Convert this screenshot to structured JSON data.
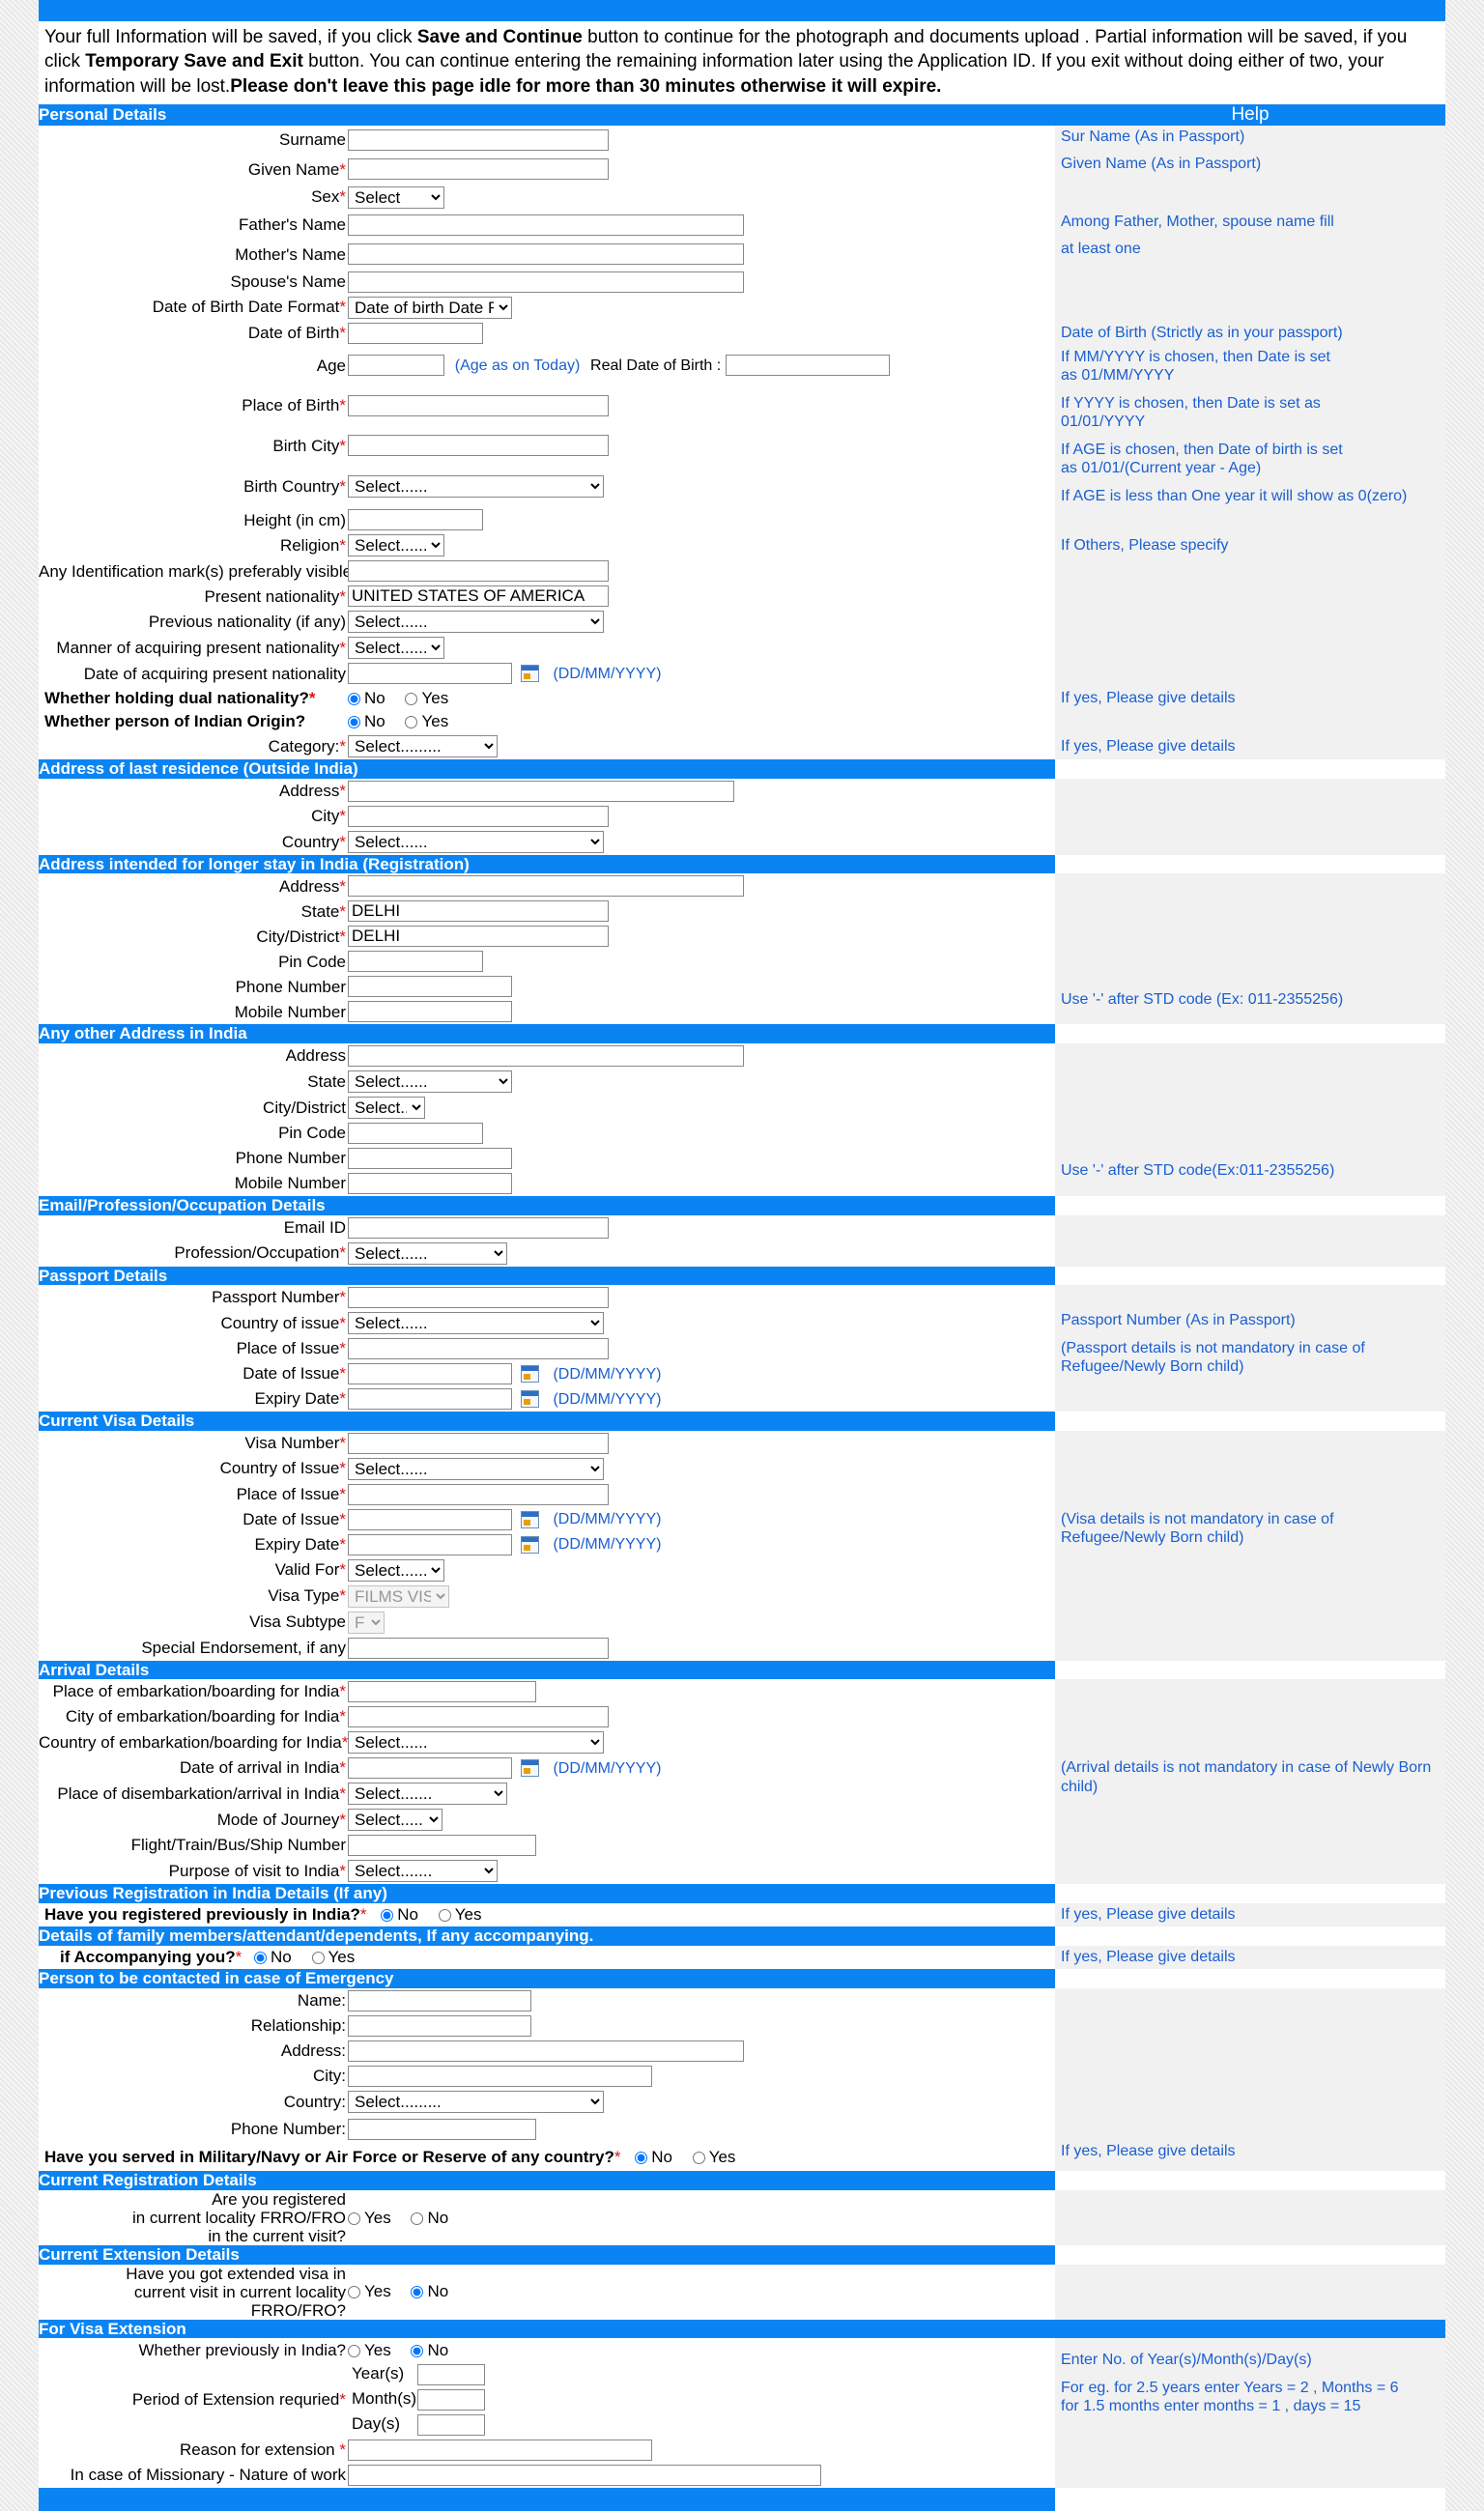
{
  "notice": {
    "part1": "Your full Information will be saved, if you click ",
    "b1": "Save and Continue",
    "part2": " button to continue for the photograph and documents upload . Partial information will be saved, if you click ",
    "b2": "Temporary Save and Exit",
    "part3": " button. You can continue entering the remaining information later using the Application ID. If you exit without doing either of two, your information will be lost.",
    "b3": "Please don't leave this page idle for more than 30 minutes otherwise it will expire."
  },
  "colors": {
    "accent": "#0b84f3",
    "help_text": "#1a5fd0",
    "required": "#d11111"
  },
  "sections": {
    "personal": "Personal Details",
    "help": "Help",
    "last_residence": "Address of last residence (Outside India)",
    "longer_stay": "Address intended for longer stay in India (Registration)",
    "other_address": "Any other Address in India",
    "email_profession": "Email/Profession/Occupation Details",
    "passport": "Passport Details",
    "current_visa": "Current Visa Details",
    "arrival": "Arrival Details",
    "previous_registration": "Previous Registration in India Details (If any)",
    "family": "Details of family members/attendant/dependents, If any accompanying.",
    "emergency": "Person to be contacted in case of Emergency",
    "current_registration": "Current Registration Details",
    "current_extension": "Current Extension Details",
    "visa_extension": "For Visa Extension"
  },
  "labels": {
    "surname": "Surname",
    "given_name": "Given Name",
    "sex": "Sex",
    "fathers_name": "Father's Name",
    "mothers_name": "Mother's Name",
    "spouses_name": "Spouse's Name",
    "dob_format": "Date of Birth Date Format",
    "dob": "Date of Birth",
    "age": "Age",
    "age_note": "(Age as on Today)",
    "real_dob": "Real Date of Birth :",
    "place_of_birth": "Place of Birth",
    "birth_city": "Birth City",
    "birth_country": "Birth Country",
    "height": "Height (in cm)",
    "religion": "Religion",
    "identification_marks": "Any Identification mark(s) preferably visible",
    "present_nationality": "Present nationality",
    "previous_nationality": "Previous nationality (if any)",
    "manner_acquiring": "Manner of acquiring present nationality",
    "date_acquiring": "Date of acquiring present nationality",
    "dual_nationality": "Whether holding dual nationality?",
    "indian_origin": "Whether person of Indian Origin?",
    "category": "Category:",
    "address": "Address",
    "city": "City",
    "country": "Country",
    "state": "State",
    "city_district": "City/District",
    "pin_code": "Pin Code",
    "phone_number": "Phone Number",
    "mobile_number": "Mobile Number",
    "email_id": "Email ID",
    "profession": "Profession/Occupation",
    "passport_number": "Passport Number",
    "country_of_issue_lc": "Country of issue",
    "country_of_issue_uc": "Country of Issue",
    "place_of_issue": "Place of Issue",
    "date_of_issue": "Date of Issue",
    "expiry_date": "Expiry Date",
    "visa_number": "Visa Number",
    "valid_for": "Valid For",
    "visa_type": "Visa Type",
    "visa_subtype": "Visa Subtype",
    "special_endorsement": "Special Endorsement, if any",
    "place_embarkation": "Place of embarkation/boarding for India",
    "city_embarkation": "City of embarkation/boarding for India",
    "country_embarkation": "Country of embarkation/boarding for India",
    "date_arrival": "Date of arrival in India",
    "place_disembarkation": "Place of disembarkation/arrival in India",
    "mode_journey": "Mode of Journey",
    "flight_number": "Flight/Train/Bus/Ship Number",
    "purpose_visit": "Purpose of visit to India",
    "registered_previously": "Have you registered previously in India?",
    "if_accompanying": "if Accompanying you?",
    "name_colon": "Name:",
    "relationship_colon": "Relationship:",
    "address_colon": "Address:",
    "city_colon": "City:",
    "country_colon": "Country:",
    "phone_colon": "Phone Number:",
    "military": "Have you served in Military/Navy or Air Force or Reserve of any country?",
    "are_you_registered": "Are you registered\nin current locality FRRO/FRO\nin the current visit?",
    "are_you_registered_l1": "Are you registered",
    "are_you_registered_l2": "in current locality FRRO/FRO",
    "are_you_registered_l3": "in the current visit?",
    "extended_visa_l1": "Have you got extended visa in",
    "extended_visa_l2": "current visit in current locality FRRO/FRO?",
    "whether_previously_india": "Whether previously in India?",
    "years": "Year(s)",
    "months": "Month(s)",
    "days": "Day(s)",
    "period_extension": "Period of Extension requried",
    "reason_extension": "Reason for extension ",
    "missionary": "In case of Missionary - Nature of work",
    "date_format_hint": "(DD/MM/YYYY)",
    "yes": "Yes",
    "no": "No"
  },
  "values": {
    "sex": "Select",
    "dob_format": "Date of birth Date Formats",
    "birth_country": "Select......",
    "religion": "Select......",
    "present_nationality": "UNITED STATES OF AMERICA",
    "previous_nationality": "Select......",
    "manner_acquiring": "Select......",
    "category": "Select.........",
    "dual_nationality": "No",
    "indian_origin": "No",
    "last_res_country": "Select......",
    "stay_state": "DELHI",
    "stay_city": "DELHI",
    "other_state": "Select......",
    "other_city": "Select......",
    "profession": "Select......",
    "passport_country": "Select......",
    "visa_country": "Select......",
    "valid_for": "Select.......",
    "visa_type": "FILMS VISA",
    "visa_subtype": "F",
    "country_embarkation": "Select......",
    "place_disembarkation": "Select.......",
    "mode_journey": "Select.......",
    "purpose_visit": "Select.......",
    "emergency_country": "Select.........",
    "registered_previously": "No",
    "if_accompanying": "No",
    "military": "No",
    "current_registration": "",
    "current_extension": "No",
    "whether_previously_india": "No"
  },
  "help": {
    "sur_name": "Sur Name (As in Passport)",
    "given_name": "Given Name (As in Passport)",
    "among_parents": "Among Father, Mother, spouse name fill",
    "at_least_one": "at least one",
    "dob_strict": "Date of Birth (Strictly as in your passport)",
    "mm_yyyy_1": "If MM/YYYY is chosen, then Date is set",
    "mm_yyyy_2": "as 01/MM/YYYY",
    "yyyy_1": "If YYYY is chosen, then Date is set as",
    "yyyy_2": "01/01/YYYY",
    "age_1": "If AGE is chosen, then Date of birth is set",
    "age_2": "as 01/01/(Current year - Age)",
    "age_3": "If AGE is less than One year it will show as 0(zero)",
    "if_others": "If Others, Please specify",
    "if_yes_details": "If yes, Please give details",
    "std_code_1": "Use '-' after STD code (Ex: 011-2355256)",
    "std_code_2": "Use '-' after STD code(Ex:011-2355256)",
    "passport_number": "Passport Number (As in Passport)",
    "passport_not_mandatory": "(Passport details is not mandatory in case of Refugee/Newly Born child)",
    "visa_not_mandatory": "(Visa details is not mandatory in case of Refugee/Newly Born child)",
    "arrival_not_mandatory": "(Arrival details is not mandatory in case of Newly Born child)",
    "enter_no_of": "Enter No. of Year(s)/Month(s)/Day(s)",
    "for_eg_1": "For eg. for 2.5 years enter Years = 2 , Months = 6",
    "for_eg_2": "for 1.5 months enter months = 1 , days = 15"
  }
}
